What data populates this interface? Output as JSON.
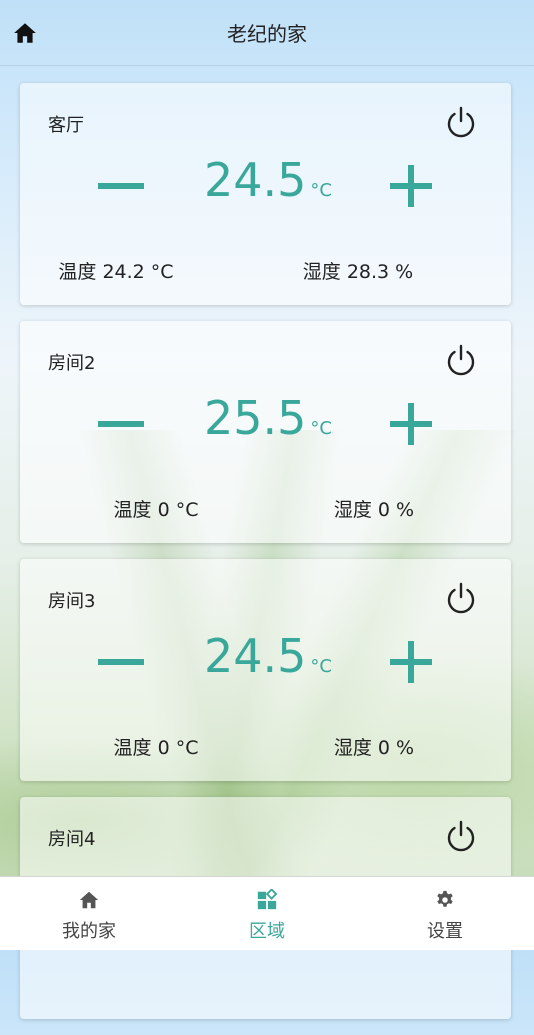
{
  "header": {
    "title": "老纪的家"
  },
  "rooms": [
    {
      "name": "客厅",
      "setpoint": "24.5",
      "unit": "°C",
      "temperature": "温度 24.2 °C",
      "humidity": "湿度 28.3 %"
    },
    {
      "name": "房间2",
      "setpoint": "25.5",
      "unit": "°C",
      "temperature": "温度 0 °C",
      "humidity": "湿度 0 %"
    },
    {
      "name": "房间3",
      "setpoint": "24.5",
      "unit": "°C",
      "temperature": "温度 0 °C",
      "humidity": "湿度 0 %"
    },
    {
      "name": "房间4",
      "setpoint": "",
      "unit": "",
      "temperature": "",
      "humidity": ""
    }
  ],
  "tabbar": {
    "tabs": [
      {
        "label": "我的家",
        "icon": "home-icon",
        "active": false
      },
      {
        "label": "区域",
        "icon": "area-icon",
        "active": true
      },
      {
        "label": "设置",
        "icon": "gear-icon",
        "active": false
      }
    ]
  },
  "colors": {
    "accent": "#3aa79b",
    "text": "#222222",
    "header_bg": "#bfe0f8"
  }
}
